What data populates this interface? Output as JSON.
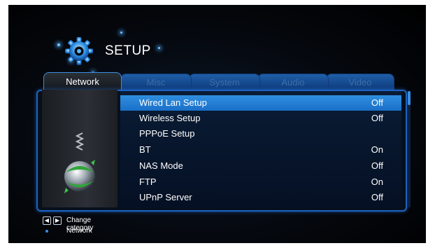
{
  "header": {
    "title": "SETUP"
  },
  "tabs": [
    {
      "label": "Network",
      "active": true
    },
    {
      "label": "Misc",
      "active": false
    },
    {
      "label": "System",
      "active": false
    },
    {
      "label": "Audio",
      "active": false
    },
    {
      "label": "Video",
      "active": false
    }
  ],
  "menu": {
    "items": [
      {
        "label": "Wired Lan Setup",
        "value": "Off",
        "selected": true
      },
      {
        "label": "Wireless Setup",
        "value": "Off",
        "selected": false
      },
      {
        "label": "PPPoE Setup",
        "value": "",
        "selected": false
      },
      {
        "label": "BT",
        "value": "On",
        "selected": false
      },
      {
        "label": "NAS Mode",
        "value": "Off",
        "selected": false
      },
      {
        "label": "FTP",
        "value": "On",
        "selected": false
      },
      {
        "label": "UPnP Server",
        "value": "Off",
        "selected": false
      }
    ]
  },
  "footer": {
    "hint": "Change category",
    "current": "Network",
    "left_key_icon": "arrow-left-key-icon",
    "right_key_icon": "arrow-right-key-icon"
  },
  "colors": {
    "accent": "#1b63c4",
    "selected_row": "#2f8fe0",
    "text": "#ffffff"
  }
}
